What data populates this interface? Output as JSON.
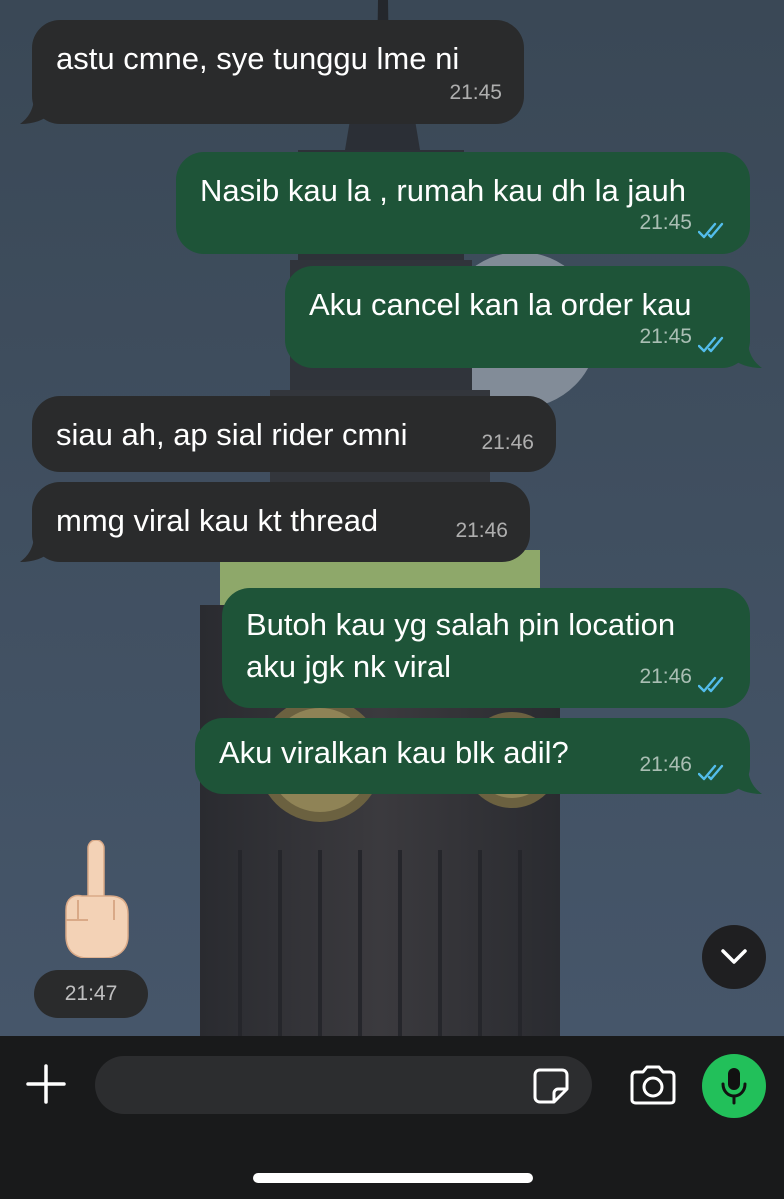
{
  "messages": [
    {
      "direction": "incoming",
      "text": "astu cmne, sye tunggu lme ni",
      "time": "21:45"
    },
    {
      "direction": "outgoing",
      "text": "Nasib kau la , rumah kau dh la jauh",
      "time": "21:45",
      "status": "read"
    },
    {
      "direction": "outgoing",
      "text": "Aku cancel kan la order kau",
      "time": "21:45",
      "status": "read"
    },
    {
      "direction": "incoming",
      "text": "siau ah, ap sial rider cmni",
      "time": "21:46"
    },
    {
      "direction": "incoming",
      "text": "mmg viral kau kt thread",
      "time": "21:46"
    },
    {
      "direction": "outgoing",
      "text": "Butoh kau yg salah pin location aku jgk nk viral",
      "time": "21:46",
      "status": "read"
    },
    {
      "direction": "outgoing",
      "text": "Aku viralkan kau blk adil?",
      "time": "21:46",
      "status": "read"
    },
    {
      "direction": "incoming",
      "emoji": "middle-finger-emoji",
      "time": "21:47"
    }
  ],
  "composer": {
    "placeholder": "",
    "icons": [
      "plus-icon",
      "sticker-icon",
      "camera-icon",
      "microphone-icon"
    ]
  },
  "colors": {
    "incoming_bubble": "#2a2b2c",
    "outgoing_bubble": "#1e5438",
    "read_ticks": "#53bdeb",
    "mic_button": "#22c05a"
  }
}
